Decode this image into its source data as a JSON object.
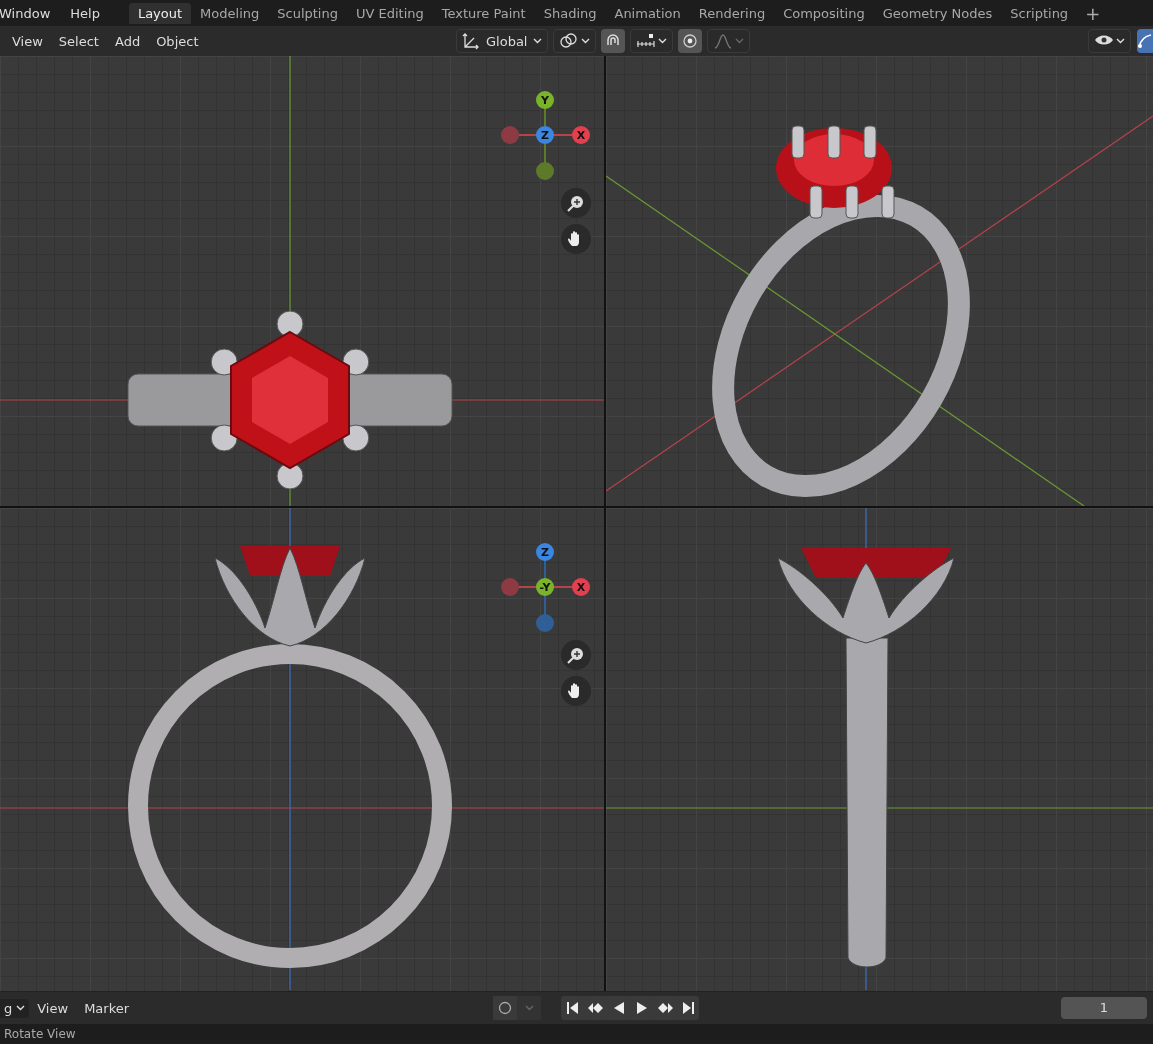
{
  "top_menu": [
    "Window",
    "Help"
  ],
  "workspace_tabs": [
    {
      "label": "Layout",
      "selected": true
    },
    {
      "label": "Modeling",
      "selected": false
    },
    {
      "label": "Sculpting",
      "selected": false
    },
    {
      "label": "UV Editing",
      "selected": false
    },
    {
      "label": "Texture Paint",
      "selected": false
    },
    {
      "label": "Shading",
      "selected": false
    },
    {
      "label": "Animation",
      "selected": false
    },
    {
      "label": "Rendering",
      "selected": false
    },
    {
      "label": "Compositing",
      "selected": false
    },
    {
      "label": "Geometry Nodes",
      "selected": false
    },
    {
      "label": "Scripting",
      "selected": false
    }
  ],
  "add_workspace": "+",
  "viewport_header": {
    "menus": [
      "View",
      "Select",
      "Add",
      "Object"
    ],
    "orientation": "Global",
    "snap_on": true,
    "proportional_on": true
  },
  "viewports": [
    {
      "kind": "top",
      "gizmo": [
        {
          "kind": "up",
          "label": "Y",
          "color": "#7ab32a"
        },
        {
          "kind": "left",
          "color": "#8e3a43"
        },
        {
          "kind": "center",
          "label": "Z",
          "color": "#3a86e0"
        },
        {
          "kind": "right",
          "label": "X",
          "color": "#e2404f"
        },
        {
          "kind": "down",
          "color": "#5d7a2a"
        }
      ]
    },
    {
      "kind": "perspective"
    },
    {
      "kind": "front",
      "gizmo": [
        {
          "kind": "up",
          "label": "Z",
          "color": "#3a86e0"
        },
        {
          "kind": "left",
          "color": "#8e3a43"
        },
        {
          "kind": "center",
          "label": "-Y",
          "color": "#7ab32a"
        },
        {
          "kind": "right",
          "label": "X",
          "color": "#e2404f"
        },
        {
          "kind": "down",
          "color": "#2f5f96"
        }
      ]
    },
    {
      "kind": "side"
    }
  ],
  "timeline": {
    "editor": "g",
    "menus": [
      "View",
      "Marker"
    ],
    "frame": "1"
  },
  "status_bar": "Rotate View"
}
